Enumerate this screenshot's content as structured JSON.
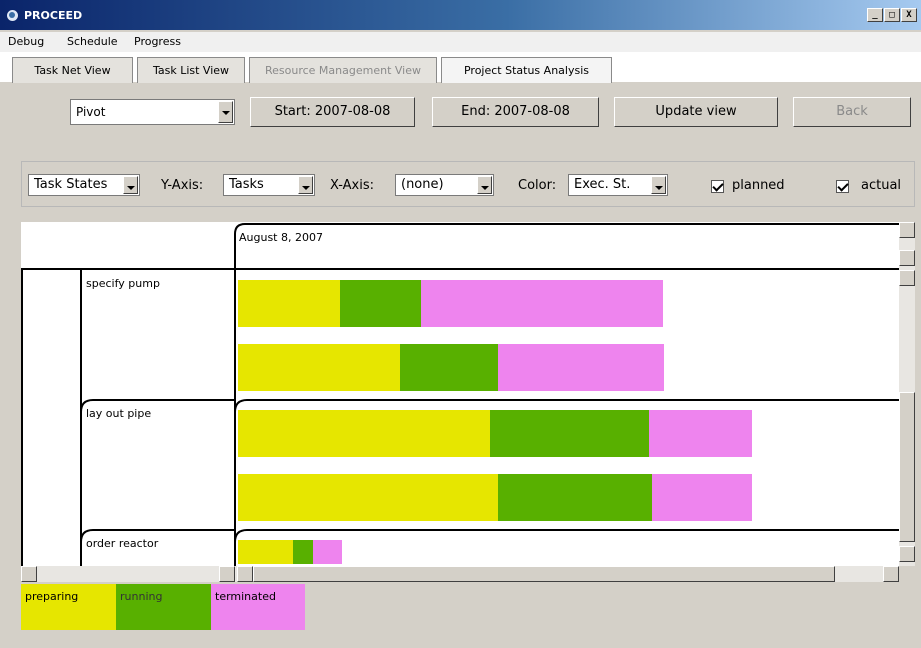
{
  "window": {
    "title": "PROCEED",
    "minimize_label": "_",
    "maximize_label": "□",
    "close_label": "X"
  },
  "menu": {
    "items": [
      "Debug",
      "Schedule",
      "Progress"
    ]
  },
  "tabs": [
    {
      "label": "Task Net View",
      "state": "normal"
    },
    {
      "label": "Task List View",
      "state": "normal"
    },
    {
      "label": "Resource Management View",
      "state": "disabled"
    },
    {
      "label": "Project Status Analysis",
      "state": "active"
    }
  ],
  "toolbar": {
    "mode_value": "Pivot",
    "start_label": "Start: 2007-08-08",
    "end_label": "End: 2007-08-08",
    "update_label": "Update view",
    "back_label": "Back"
  },
  "filters": {
    "measure_value": "Task States",
    "y_axis_label": "Y-Axis:",
    "y_axis_value": "Tasks",
    "x_axis_label": "X-Axis:",
    "x_axis_value": "(none)",
    "color_label": "Color:",
    "color_value": "Exec. St.",
    "planned_label": "planned",
    "planned_checked": true,
    "actual_label": "actual",
    "actual_checked": true
  },
  "chart": {
    "date_header": "August 8, 2007",
    "colors": {
      "preparing": "#e6e600",
      "running": "#58b000",
      "terminated": "#ee84ee"
    },
    "tasks": [
      {
        "name": "specify pump",
        "bars": [
          {
            "kind": "planned",
            "preparing": 0.24,
            "running": 0.19,
            "terminated": 0.57
          },
          {
            "kind": "actual",
            "preparing": 0.38,
            "running": 0.23,
            "terminated": 0.39
          }
        ]
      },
      {
        "name": "lay out pipe",
        "bars": [
          {
            "kind": "planned",
            "preparing": 0.49,
            "running": 0.31,
            "terminated": 0.2
          },
          {
            "kind": "actual",
            "preparing": 0.506,
            "running": 0.3,
            "terminated": 0.194
          }
        ]
      },
      {
        "name": "order reactor",
        "bars": [
          {
            "kind": "planned",
            "preparing": 0.53,
            "running": 0.19,
            "terminated": 0.28
          }
        ]
      }
    ]
  },
  "legend": [
    {
      "label": "preparing",
      "color": "#e6e600"
    },
    {
      "label": "running",
      "color": "#58b000"
    },
    {
      "label": "terminated",
      "color": "#ee84ee"
    }
  ]
}
